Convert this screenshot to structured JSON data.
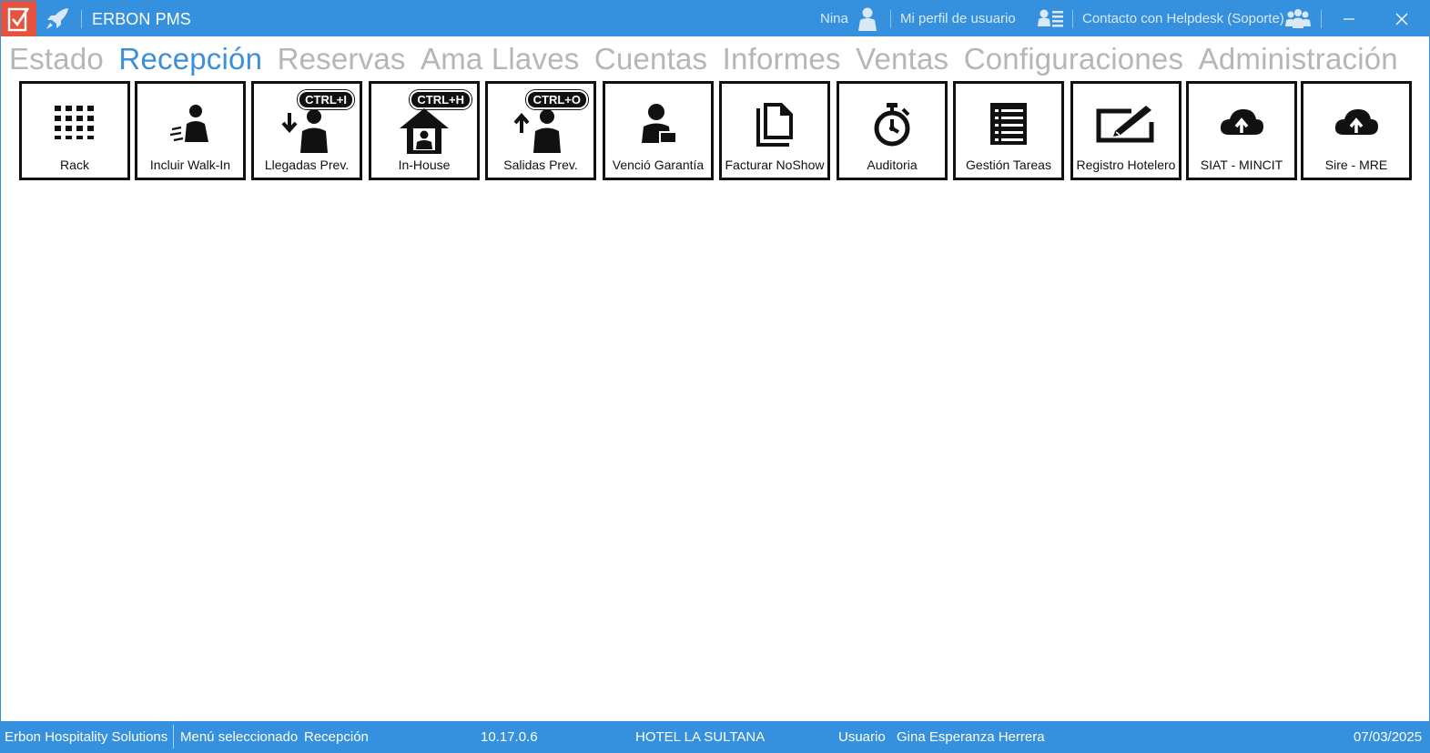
{
  "titlebar": {
    "app_title": "ERBON PMS",
    "user_name": "Nina",
    "profile_label": "Mi perfil de usuario",
    "helpdesk_label": "Contacto con Helpdesk (Soporte)",
    "accent_color": "#3591dd",
    "logo_color": "#e5533e"
  },
  "menu": {
    "tabs": [
      {
        "label": "Estado"
      },
      {
        "label": "Recepción"
      },
      {
        "label": "Reservas"
      },
      {
        "label": "Ama Llaves"
      },
      {
        "label": "Cuentas"
      },
      {
        "label": "Informes"
      },
      {
        "label": "Ventas"
      },
      {
        "label": "Configuraciones"
      },
      {
        "label": "Administración"
      }
    ],
    "active": "Recepción",
    "active_color": "#3f8fd8",
    "inactive_color": "#b6b6b6"
  },
  "ribbon": {
    "buttons": [
      {
        "label": "Rack",
        "icon": "grid-icon"
      },
      {
        "label": "Incluir Walk-In",
        "icon": "walk-in-person-icon"
      },
      {
        "label": "Llegadas Prev.",
        "icon": "arrival-person-icon",
        "shortcut": "CTRL+I"
      },
      {
        "label": "In-House",
        "icon": "house-person-icon",
        "shortcut": "CTRL+H"
      },
      {
        "label": "Salidas Prev.",
        "icon": "departure-person-icon",
        "shortcut": "CTRL+O"
      },
      {
        "label": "Venció Garantía",
        "icon": "person-card-icon"
      },
      {
        "label": "Facturar NoShow",
        "icon": "document-icon"
      },
      {
        "label": "Auditoria",
        "icon": "stopwatch-icon"
      },
      {
        "label": "Gestión Tareas",
        "icon": "task-list-icon"
      },
      {
        "label": "Registro Hotelero",
        "icon": "edit-box-icon"
      },
      {
        "label": "SIAT - MINCIT",
        "icon": "cloud-upload-icon"
      },
      {
        "label": "Sire - MRE",
        "icon": "cloud-upload-icon"
      }
    ]
  },
  "statusbar": {
    "company": "Erbon Hospitality Solutions",
    "menu_selected_label": "Menú seleccionado",
    "menu_selected_value": "Recepción",
    "version": "10.17.0.6",
    "hotel": "HOTEL LA SULTANA",
    "user_label": "Usuario",
    "user_full_name": "Gina Esperanza Herrera",
    "date": "07/03/2025"
  }
}
